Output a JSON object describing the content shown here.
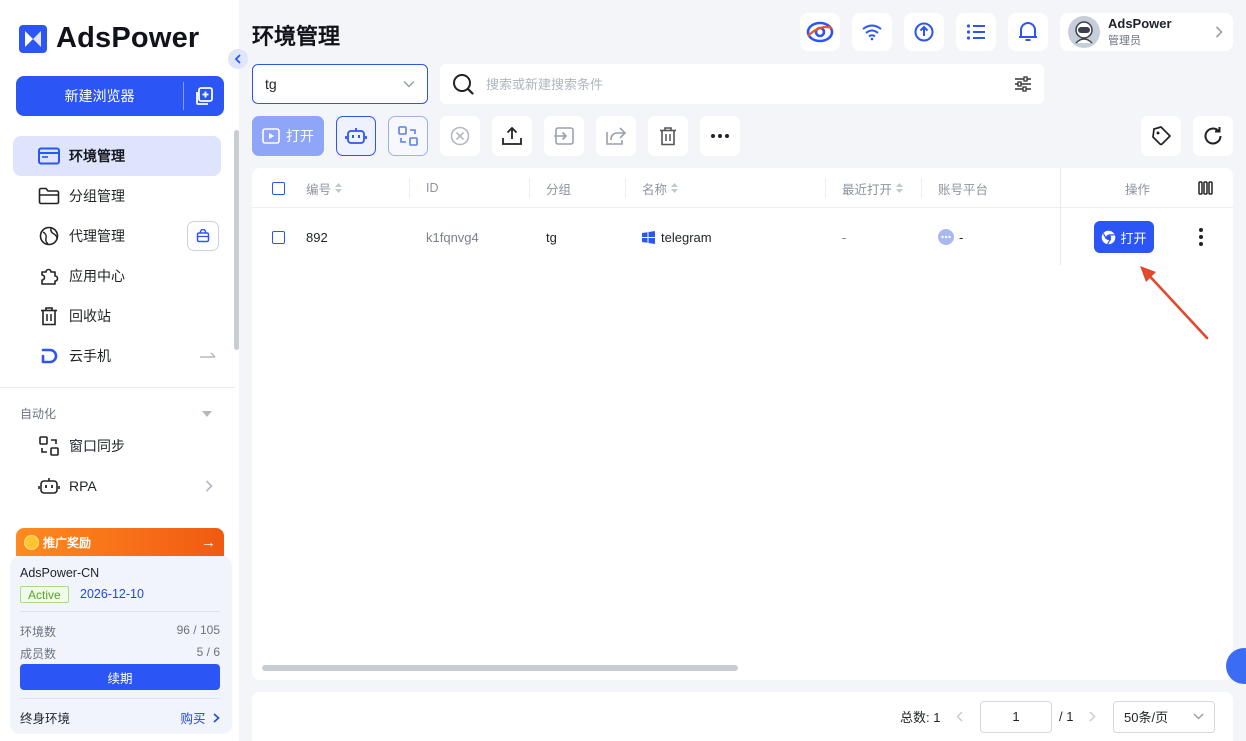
{
  "app": {
    "name": "AdsPower",
    "accent": "#2b55f5"
  },
  "sidebar": {
    "new_browser_label": "新建浏览器",
    "nav": [
      {
        "label": "环境管理",
        "icon": "browser-window-icon",
        "active": true
      },
      {
        "label": "分组管理",
        "icon": "folder-icon"
      },
      {
        "label": "代理管理",
        "icon": "globe-icon"
      },
      {
        "label": "应用中心",
        "icon": "puzzle-icon"
      },
      {
        "label": "回收站",
        "icon": "trash-icon"
      },
      {
        "label": "云手机",
        "icon": "cloud-phone-icon"
      }
    ],
    "automation_label": "自动化",
    "automation": [
      {
        "label": "窗口同步",
        "icon": "window-sync-icon"
      },
      {
        "label": "RPA",
        "icon": "robot-icon"
      }
    ],
    "promo_label": "推广奖励",
    "plan": {
      "name": "AdsPower-CN",
      "status": "Active",
      "expiry": "2026-12-10",
      "env_label": "环境数",
      "env_value": "96 / 105",
      "member_label": "成员数",
      "member_value": "5 / 6",
      "renew_label": "续期",
      "lifetime_label": "终身环境",
      "buy_label": "购买"
    }
  },
  "header": {
    "title": "环境管理",
    "icons": [
      "adspower-logo-icon",
      "wifi-icon",
      "sync-icon",
      "task-list-icon",
      "bell-icon"
    ],
    "user": {
      "name": "AdsPower",
      "role": "管理员"
    }
  },
  "filter": {
    "group_value": "tg",
    "search_placeholder": "搜索或新建搜索条件"
  },
  "toolbar": {
    "open_label": "打开"
  },
  "table": {
    "columns": {
      "number": "编号",
      "id": "ID",
      "group": "分组",
      "name": "名称",
      "last_open": "最近打开",
      "platform": "账号平台",
      "actions": "操作"
    },
    "rows": [
      {
        "number": "892",
        "id": "k1fqnvg4",
        "group": "tg",
        "name": "telegram",
        "last_open": "-",
        "platform": "-",
        "open_label": "打开"
      }
    ]
  },
  "pagination": {
    "total_label": "总数: 1",
    "current_page": "1",
    "total_pages": "/ 1",
    "page_size": "50条/页"
  }
}
